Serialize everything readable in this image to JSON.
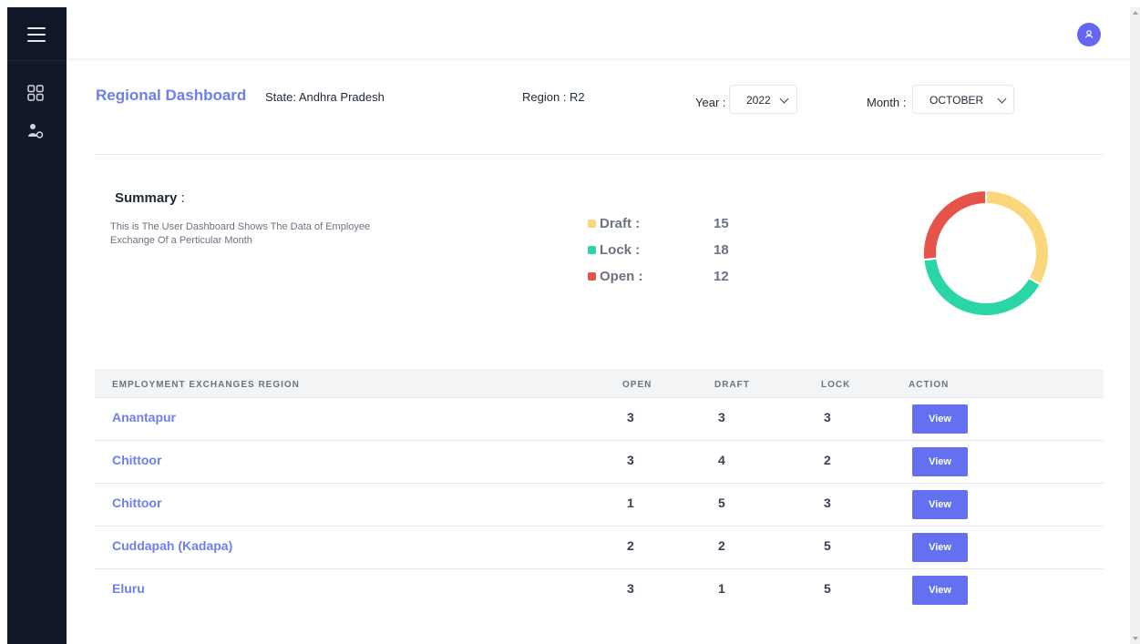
{
  "header": {
    "title": "Regional Dashboard",
    "state": "State: Andhra Pradesh",
    "region": "Region : R2",
    "year_label": "Year :",
    "year_value": "2022",
    "month_label": "Month :",
    "month_value": "OCTOBER"
  },
  "icons": {
    "menu": "hamburger-menu-icon",
    "dashboard": "grid-icon",
    "users": "user-settings-icon",
    "profile": "user-avatar-icon"
  },
  "colors": {
    "accent": "#6b7ff0",
    "button": "#6470f0",
    "sidebar": "#111827",
    "draft": "#fad77b",
    "lock": "#2ad6a5",
    "open": "#e6534a"
  },
  "summary": {
    "title": "Summary",
    "colon": " :",
    "description": "This is The User Dashboard Shows The Data of Employee Exchange Of a Perticular Month",
    "legend": [
      {
        "label": "Draft :",
        "value": 15,
        "color": "#fad77b"
      },
      {
        "label": "Lock :",
        "value": 18,
        "color": "#2ad6a5"
      },
      {
        "label": "Open :",
        "value": 12,
        "color": "#e6534a"
      }
    ]
  },
  "chart_data": {
    "type": "pie",
    "donut": true,
    "categories": [
      "Draft",
      "Lock",
      "Open"
    ],
    "values": [
      15,
      18,
      12
    ],
    "colors": [
      "#fad77b",
      "#2ad6a5",
      "#e6534a"
    ],
    "title": ""
  },
  "table": {
    "headers": [
      "EMPLOYMENT EXCHANGES REGION",
      "OPEN",
      "DRAFT",
      "LOCK",
      "ACTION"
    ],
    "rows": [
      {
        "name": "Anantapur",
        "open": "3",
        "draft": "3",
        "lock": "3",
        "action": "View"
      },
      {
        "name": "Chittoor",
        "open": "3",
        "draft": "4",
        "lock": "2",
        "action": "View"
      },
      {
        "name": "Chittoor",
        "open": "1",
        "draft": "5",
        "lock": "3",
        "action": "View"
      },
      {
        "name": "Cuddapah (Kadapa)",
        "open": "2",
        "draft": "2",
        "lock": "5",
        "action": "View"
      },
      {
        "name": "Eluru",
        "open": "3",
        "draft": "1",
        "lock": "5",
        "action": "View"
      }
    ]
  }
}
